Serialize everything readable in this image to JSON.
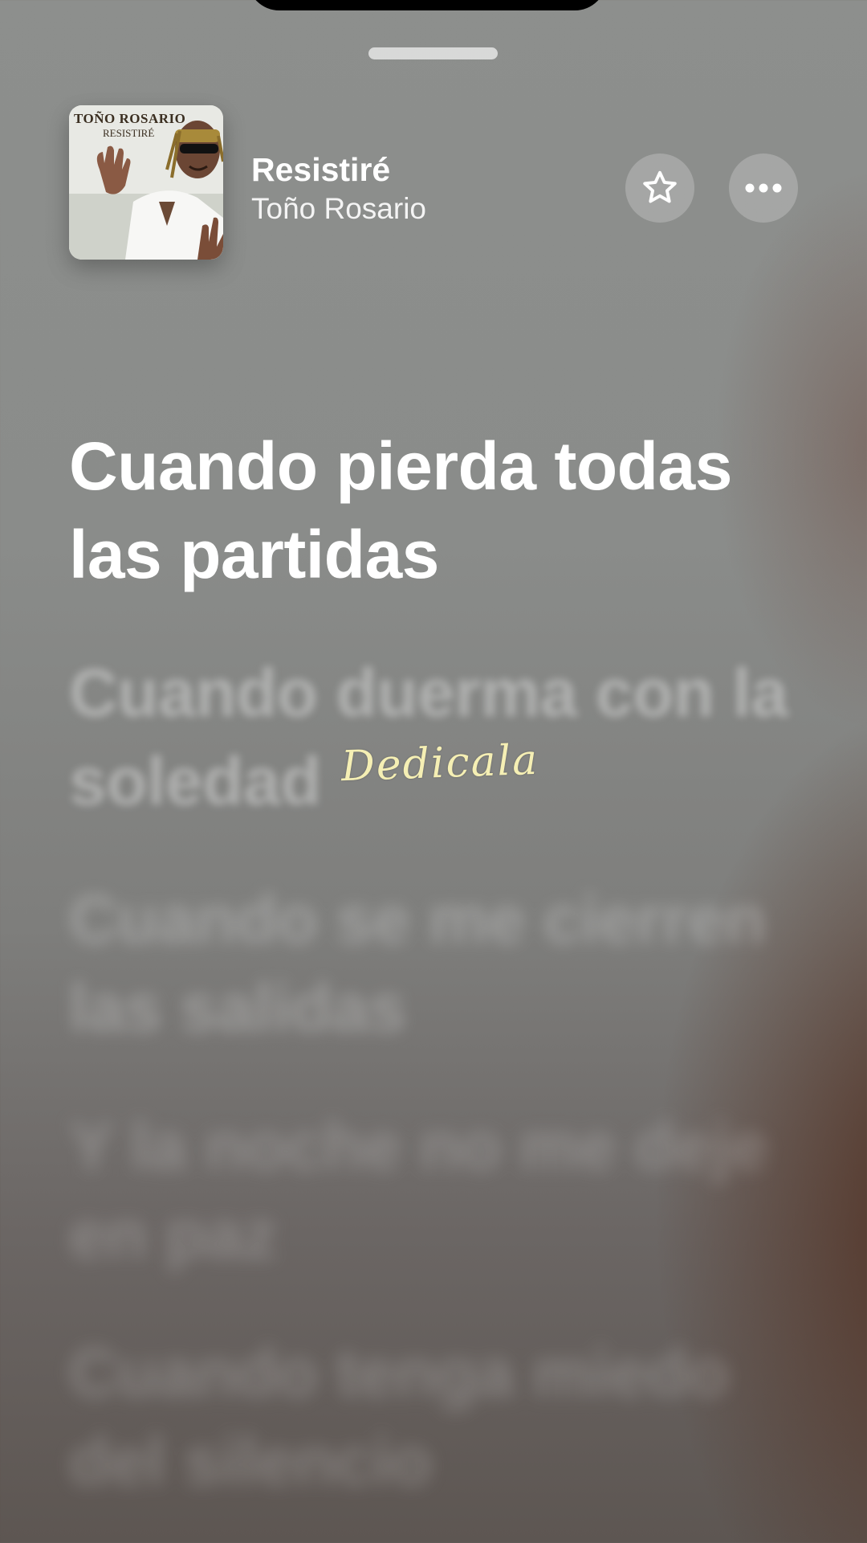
{
  "album_art": {
    "title_text": "TOÑO ROSARIO",
    "subtitle_text": "RESISTIRÉ"
  },
  "song": {
    "title": "Resistiré",
    "artist": "Toño Rosario"
  },
  "icons": {
    "favorite": "star-icon",
    "more": "ellipsis-icon"
  },
  "lyrics": [
    "Cuando pierda todas las partidas",
    "Cuando duerma con la soledad",
    "Cuando se me cierren las salidas",
    "Y la noche no me deje en paz",
    "Cuando tenga miedo del silencio"
  ],
  "overlay_text": "Dedicala"
}
